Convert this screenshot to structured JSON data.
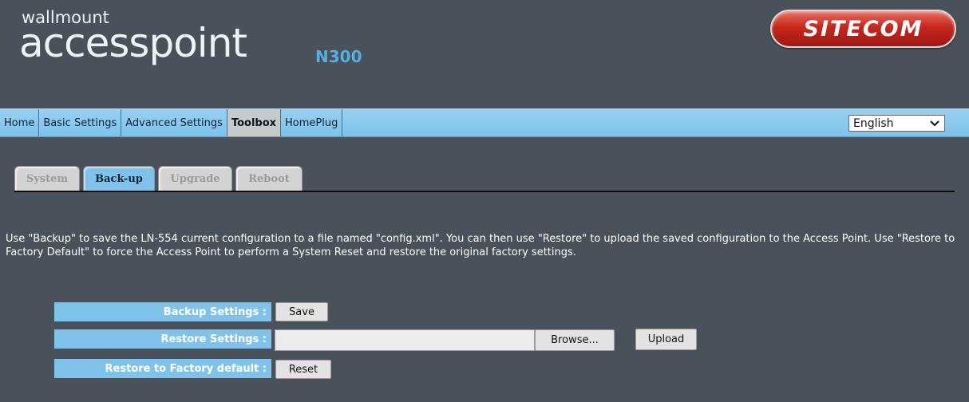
{
  "header": {
    "brand_small": "wallmount",
    "brand_big": "accesspoint",
    "brand_model": "N300",
    "logo": "SITECOM"
  },
  "nav": {
    "items": [
      "Home",
      "Basic Settings",
      "Advanced Settings",
      "Toolbox",
      "HomePlug"
    ],
    "active": "Toolbox",
    "language": "English"
  },
  "tabs": {
    "items": [
      "System",
      "Back-up",
      "Upgrade",
      "Reboot"
    ],
    "active": "Back-up"
  },
  "description": "Use \"Backup\" to save the LN-554 current configuration to a file named \"config.xml\". You can then use \"Restore\" to upload the saved configuration to the Access Point. Use \"Restore to Factory Default\" to force the Access Point to perform a System Reset and restore the original factory settings.",
  "settings": {
    "backup_label": "Backup Settings :",
    "backup_button": "Save",
    "restore_label": "Restore Settings :",
    "browse_button": "Browse...",
    "upload_button": "Upload",
    "factory_label": "Restore to Factory default :",
    "reset_button": "Reset"
  },
  "colors": {
    "background": "#49525a",
    "nav_bar": "#7cc2ec",
    "accent": "#7fc3ea",
    "model_text": "#4fb0e3",
    "logo_red": "#c8261b"
  }
}
